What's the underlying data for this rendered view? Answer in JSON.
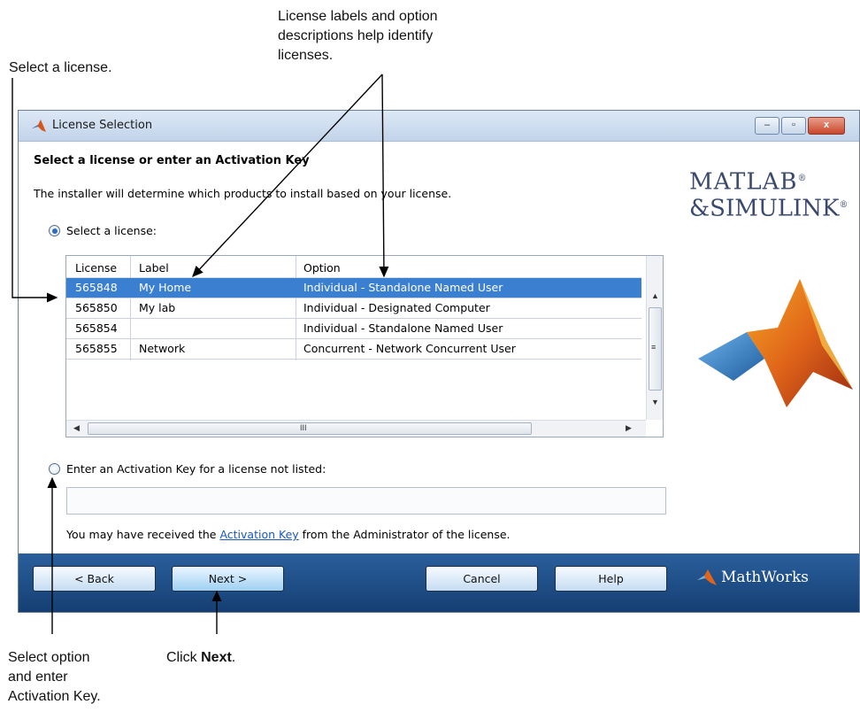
{
  "callouts": {
    "select_license": "Select a license.",
    "labels_line1": "License labels and option",
    "labels_line2": "descriptions help identify",
    "labels_line3": "licenses.",
    "option_line1": "Select option",
    "option_line2": "and enter",
    "option_line3": "Activation Key.",
    "click_prefix": "Click ",
    "click_bold": "Next",
    "click_suffix": "."
  },
  "window": {
    "title": "License Selection",
    "controls": [
      "–",
      "▫",
      "x"
    ]
  },
  "main": {
    "heading": "Select a license or enter an Activation Key",
    "subtext": "The installer will determine which products to install based on your license.",
    "radio_select": "Select a license:",
    "radio_key": "Enter an Activation Key for a license not listed:",
    "key_input_value": "",
    "note_prefix": "You may have received the ",
    "note_link": "Activation Key",
    "note_suffix": " from the Administrator of the license."
  },
  "logo": {
    "line1": "MATLAB",
    "line2": "&SIMULINK",
    "reg": "®"
  },
  "table": {
    "columns": [
      "License",
      "Label",
      "Option"
    ],
    "rows": [
      {
        "license": "565848",
        "label": "My Home",
        "option": "Individual - Standalone Named User"
      },
      {
        "license": "565850",
        "label": "My lab",
        "option": "Individual - Designated Computer"
      },
      {
        "license": "565854",
        "label": "",
        "option": "Individual - Standalone Named User"
      },
      {
        "license": "565855",
        "label": "Network",
        "option": "Concurrent - Network Concurrent User"
      }
    ],
    "hscroll_glyph": "III",
    "vscroll_glyph": "≡"
  },
  "footer": {
    "back": "< Back",
    "next": "Next >",
    "cancel": "Cancel",
    "help": "Help",
    "brand": "MathWorks"
  },
  "colors": {
    "selected_row": "#3b7fd1",
    "footer": "#1f4f88",
    "accent_orange": "#e0651a"
  }
}
